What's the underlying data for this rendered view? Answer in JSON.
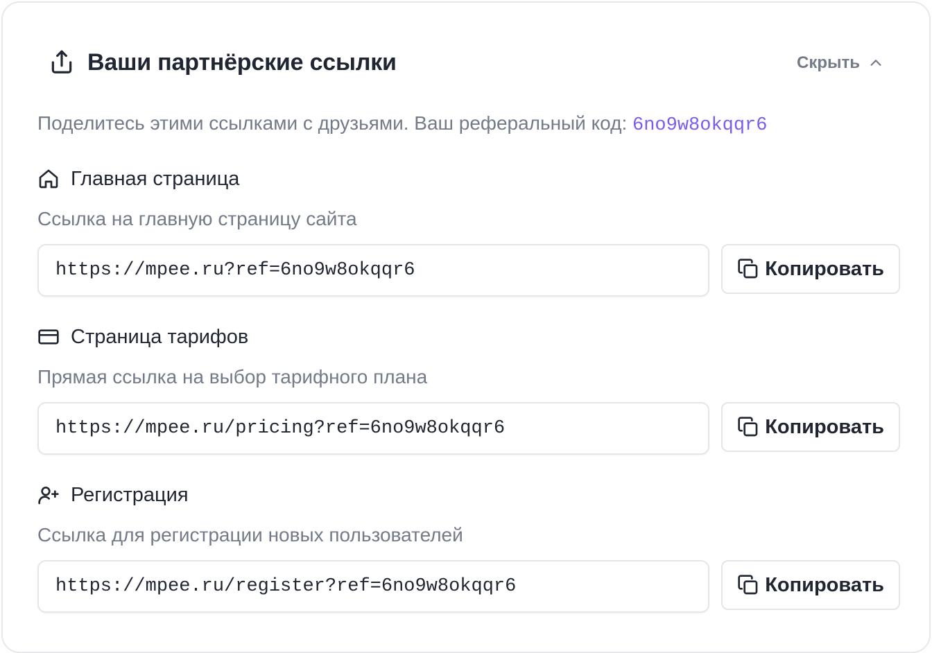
{
  "header": {
    "title": "Ваши партнёрские ссылки",
    "title_icon": "share-upload-icon",
    "toggle_label": "Скрыть",
    "toggle_icon": "chevron-up-icon"
  },
  "intro": {
    "text": "Поделитесь этими ссылками с друзьями. Ваш реферальный код: ",
    "code": "6no9w8okqqr6"
  },
  "sections": [
    {
      "icon": "home-icon",
      "title": "Главная страница",
      "description": "Ссылка на главную страницу сайта",
      "url": "https://mpee.ru?ref=6no9w8okqqr6",
      "copy_label": "Копировать"
    },
    {
      "icon": "credit-card-icon",
      "title": "Страница тарифов",
      "description": "Прямая ссылка на выбор тарифного плана",
      "url": "https://mpee.ru/pricing?ref=6no9w8okqqr6",
      "copy_label": "Копировать"
    },
    {
      "icon": "user-plus-icon",
      "title": "Регистрация",
      "description": "Ссылка для регистрации новых пользователей",
      "url": "https://mpee.ru/register?ref=6no9w8okqqr6",
      "copy_label": "Копировать"
    }
  ],
  "colors": {
    "accent_code": "#7a5cf0",
    "text_primary": "#1f2531",
    "text_muted": "#737b88",
    "border": "#e4e6ea"
  }
}
